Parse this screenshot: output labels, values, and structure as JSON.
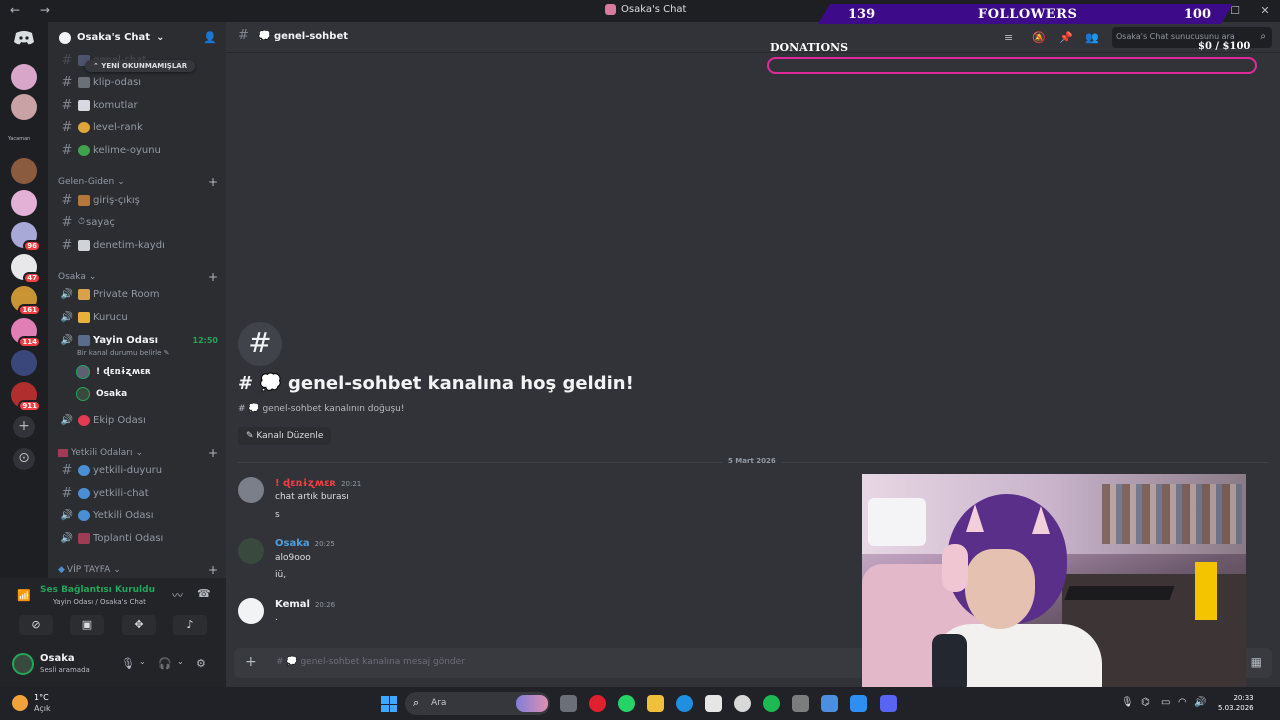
{
  "window": {
    "title": "Osaka's Chat",
    "nav_icons": "← →",
    "controls": [
      "—",
      "☐",
      "✕"
    ]
  },
  "overlay": {
    "followers_count": "139",
    "followers_label": "FOLLOWERS",
    "followers_goal": "100",
    "donations_label": "DONATIONS",
    "donations_amount": "$0  / $100",
    "donations_progress": 0,
    "accent": "#3d0b8a",
    "donation_border": "#e02a9b"
  },
  "rail": {
    "small_label": "Yacaman",
    "badges": [
      "96",
      "47",
      "161",
      "114",
      "911"
    ]
  },
  "guild": {
    "name": "Osaka's Chat",
    "chevron": "⌄"
  },
  "unread_pill": "⌃ YENİ OKUNMAMIŞLAR",
  "sidebar": {
    "channels_top": [
      {
        "label": "genel-chat",
        "icon": "chat-icon"
      },
      {
        "label": "klip-odası",
        "icon": "film-icon"
      },
      {
        "label": "komutlar",
        "icon": "chart-icon"
      },
      {
        "label": "level-rank",
        "icon": "medal-icon"
      },
      {
        "label": "kelime-oyunu",
        "icon": "clover-icon"
      }
    ],
    "cat_gelen": "Gelen-Giden",
    "channels_gelen": [
      {
        "label": "giriş-çıkış",
        "icon": "door-icon"
      },
      {
        "label": "sayaç",
        "icon": "timer-icon"
      },
      {
        "label": "denetim-kaydı",
        "icon": "log-icon"
      }
    ],
    "cat_osaka": "Osaka",
    "voice_channels": [
      {
        "label": "Private Room",
        "icon": "gift-icon"
      },
      {
        "label": "Kurucu",
        "icon": "crown-icon"
      },
      {
        "label": "Yayin Odası",
        "icon": "tv-icon",
        "time": "12:50"
      }
    ],
    "voice_status": "Bir kanal durumu belirle ✎",
    "voice_users": [
      "! ɖɛռɨʐʍɛʀ",
      "Osaka"
    ],
    "voice_channels_2": [
      {
        "label": "Ekip Odası",
        "icon": "no-entry-icon"
      }
    ],
    "cat_yetkili": "Yetkili Odaları",
    "channels_yetkili": [
      {
        "label": "yetkili-duyuru",
        "icon": "globe-icon",
        "kind": "text"
      },
      {
        "label": "yetkili-chat",
        "icon": "globe-icon",
        "kind": "text"
      },
      {
        "label": "Yetkili Odası",
        "icon": "globe-icon",
        "kind": "voice"
      },
      {
        "label": "Toplanti Odası",
        "icon": "briefcase-icon",
        "kind": "voice"
      }
    ],
    "cat_vip": "VİP TAYFA"
  },
  "voice_panel": {
    "status": "Ses Bağlantısı Kuruldu",
    "location": "Yayin Odası / Osaka's Chat"
  },
  "user_panel": {
    "name": "Osaka",
    "status": "Sesli aramada"
  },
  "channel": {
    "name": "genel-sohbet"
  },
  "header": {
    "search_placeholder": "Osaka's Chat sunucusunu ara"
  },
  "welcome": {
    "title": "# 💭 genel-sohbet kanalına hoş geldin!",
    "subtitle": "# 💭 genel-sohbet kanalının doğuşu!",
    "edit_button": "Kanalı Düzenle"
  },
  "date_divider": "5 Mart 2026",
  "messages": [
    {
      "author": "! ɖɛռɨʐʍɛʀ",
      "time": "20:21",
      "color": "#f23f43",
      "lines": [
        "chat artık burası",
        "s"
      ]
    },
    {
      "author": "Osaka",
      "time": "20:25",
      "color": "#4e9fe0",
      "lines": [
        "alo9ooo",
        "iü,"
      ]
    },
    {
      "author": "Kemal",
      "time": "20:26",
      "color": "#f2f3f5",
      "lines": [
        "."
      ]
    }
  ],
  "composer": {
    "placeholder": "# 💭 genel-sohbet kanalına mesaj gönder"
  },
  "taskbar": {
    "temp": "1°C",
    "condition": "Açık",
    "search_label": "Ara",
    "time": "20:33",
    "date": "5.03.2026"
  }
}
